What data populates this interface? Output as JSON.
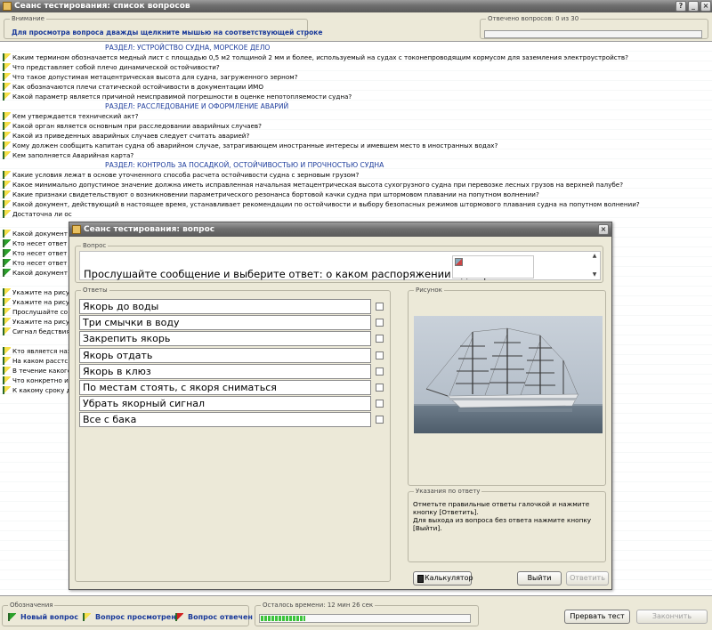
{
  "main": {
    "title": "Сеанс тестирования: список вопросов",
    "attention": {
      "legend": "Внимание",
      "text": "Для просмотра вопроса дважды щелкните мышью на соответствующей строке"
    },
    "answered": {
      "label": "Отвечено вопросов: 0 из 30",
      "value": 0,
      "total": 30
    }
  },
  "question_list": [
    {
      "type": "section",
      "text": "РАЗДЕЛ: УСТРОЙСТВО СУДНА, МОРСКОЕ ДЕЛО"
    },
    {
      "type": "item",
      "status": "viewed",
      "text": "Каким термином обозначается медный лист с площадью 0,5 м2 толщиной 2 мм и более, используемый на судах с токонепроводящим кормусом для заземления электроустройств?"
    },
    {
      "type": "item",
      "status": "viewed",
      "text": "Что представляет собой плечо динамической остойчивости?"
    },
    {
      "type": "item",
      "status": "viewed",
      "text": "Что такое допустимая метацентрическая высота для судна, загруженного зерном?"
    },
    {
      "type": "item",
      "status": "viewed",
      "text": "Как обозначаются плечи статической остойчивости в документации ИМО"
    },
    {
      "type": "item",
      "status": "viewed",
      "text": "Какой параметр является причиной неисправимой погрешности в оценке непотопляемости судна?"
    },
    {
      "type": "section",
      "text": "РАЗДЕЛ: РАССЛЕДОВАНИЕ И ОФОРМЛЕНИЕ АВАРИЙ"
    },
    {
      "type": "item",
      "status": "viewed",
      "text": "Кем утверждается технический акт?"
    },
    {
      "type": "item",
      "status": "viewed",
      "text": "Какой орган является основным при расследовании аварийных случаев?"
    },
    {
      "type": "item",
      "status": "viewed",
      "text": "Какой из приведенных аварийных случаев следует считать аварией?"
    },
    {
      "type": "item",
      "status": "viewed",
      "text": "Кому должен сообщить капитан судна об аварийном случае, затрагивающем иностранные интересы и имевшем место в иностранных водах?"
    },
    {
      "type": "item",
      "status": "viewed",
      "text": "Кем заполняется Аварийная карта?"
    },
    {
      "type": "section",
      "text": "РАЗДЕЛ: КОНТРОЛЬ ЗА ПОСАДКОЙ, ОСТОЙЧИВОСТЬЮ И ПРОЧНОСТЬЮ СУДНА"
    },
    {
      "type": "item",
      "status": "viewed",
      "text": "Какие условия лежат в основе уточненного способа расчета остойчивости судна с зерновым грузом?"
    },
    {
      "type": "item",
      "status": "viewed",
      "text": "Какое минимально допустимое значение должна иметь исправленная начальная метацентрическая высота сухогрузного судна при перевозке лесных грузов на верхней палубе?"
    },
    {
      "type": "item",
      "status": "viewed",
      "text": "Какие признаки свидетельствуют о возникновении параметрического резонанса бортовой качки судна при штормовом плавании на попутном волнении?"
    },
    {
      "type": "item",
      "status": "viewed",
      "text": "Какой документ, действующий в настоящее время, устанавливает рекомендации по остойчивости и выбору безопасных режимов штормового плавания судна на попутном волнении?"
    },
    {
      "type": "item",
      "status": "viewed",
      "text": "Достаточна ли ос"
    },
    {
      "type": "blank",
      "text": ""
    },
    {
      "type": "item",
      "status": "viewed",
      "text": "Какой документ"
    },
    {
      "type": "item",
      "status": "new",
      "text": "Кто несет ответ"
    },
    {
      "type": "item",
      "status": "new",
      "text": "Кто несет ответ"
    },
    {
      "type": "item",
      "status": "new",
      "text": "Кто несет ответ"
    },
    {
      "type": "item",
      "status": "new",
      "text": "Какой документ"
    },
    {
      "type": "blank",
      "text": ""
    },
    {
      "type": "item",
      "status": "viewed",
      "text": "Укажите на рису"
    },
    {
      "type": "item",
      "status": "viewed",
      "text": "Укажите на рису"
    },
    {
      "type": "item",
      "status": "viewed",
      "text": "Прослушайте со"
    },
    {
      "type": "item",
      "status": "viewed",
      "text": "Укажите на рису"
    },
    {
      "type": "item",
      "status": "viewed",
      "text": "Сигнал бедствия"
    },
    {
      "type": "blank",
      "text": ""
    },
    {
      "type": "item",
      "status": "viewed",
      "text": "Кто является наз"
    },
    {
      "type": "item",
      "status": "viewed",
      "text": "На каком расстс"
    },
    {
      "type": "item",
      "status": "viewed",
      "text": "В течение какого"
    },
    {
      "type": "item",
      "status": "viewed",
      "text": "Что конкретно и"
    },
    {
      "type": "item",
      "status": "viewed",
      "text": "К какому сроку д"
    }
  ],
  "legend": {
    "title": "Обозначения",
    "new": "Новый вопрос",
    "viewed": "Вопрос просмотрен",
    "answered": "Вопрос отвечен"
  },
  "time": {
    "label": "Осталось времени: 12 мин 26 сек",
    "progress": 0.21
  },
  "buttons": {
    "abort": "Прервать тест",
    "finish": "Закончить"
  },
  "dialog": {
    "title": "Сеанс тестирования: вопрос",
    "question_legend": "Вопрос",
    "question_text": "Прослушайте сообщение и выберите ответ: о каком распоряжении идет речь?",
    "answers_legend": "Ответы",
    "answers": [
      "Якорь до воды",
      "Три смычки в воду",
      "Закрепить якорь",
      "Якорь отдать",
      "Якорь в клюз",
      "По местам стоять, с якоря сниматься",
      "Убрать якорный сигнал",
      "Все с бака"
    ],
    "picture_legend": "Рисунок",
    "hint_legend": "Указания по ответу",
    "hint_lines": [
      "Отметьте правильные ответы галочкой и нажмите кнопку [Ответить].",
      "Для выхода из вопроса без ответа нажмите кнопку [Выйти]."
    ],
    "calculator": "Калькулятор",
    "exit": "Выйти",
    "answer": "Ответить"
  },
  "colors": {
    "accent": "#1a3a9a",
    "progress": "#3cc43c",
    "titlebar": "#6e6e6e"
  }
}
